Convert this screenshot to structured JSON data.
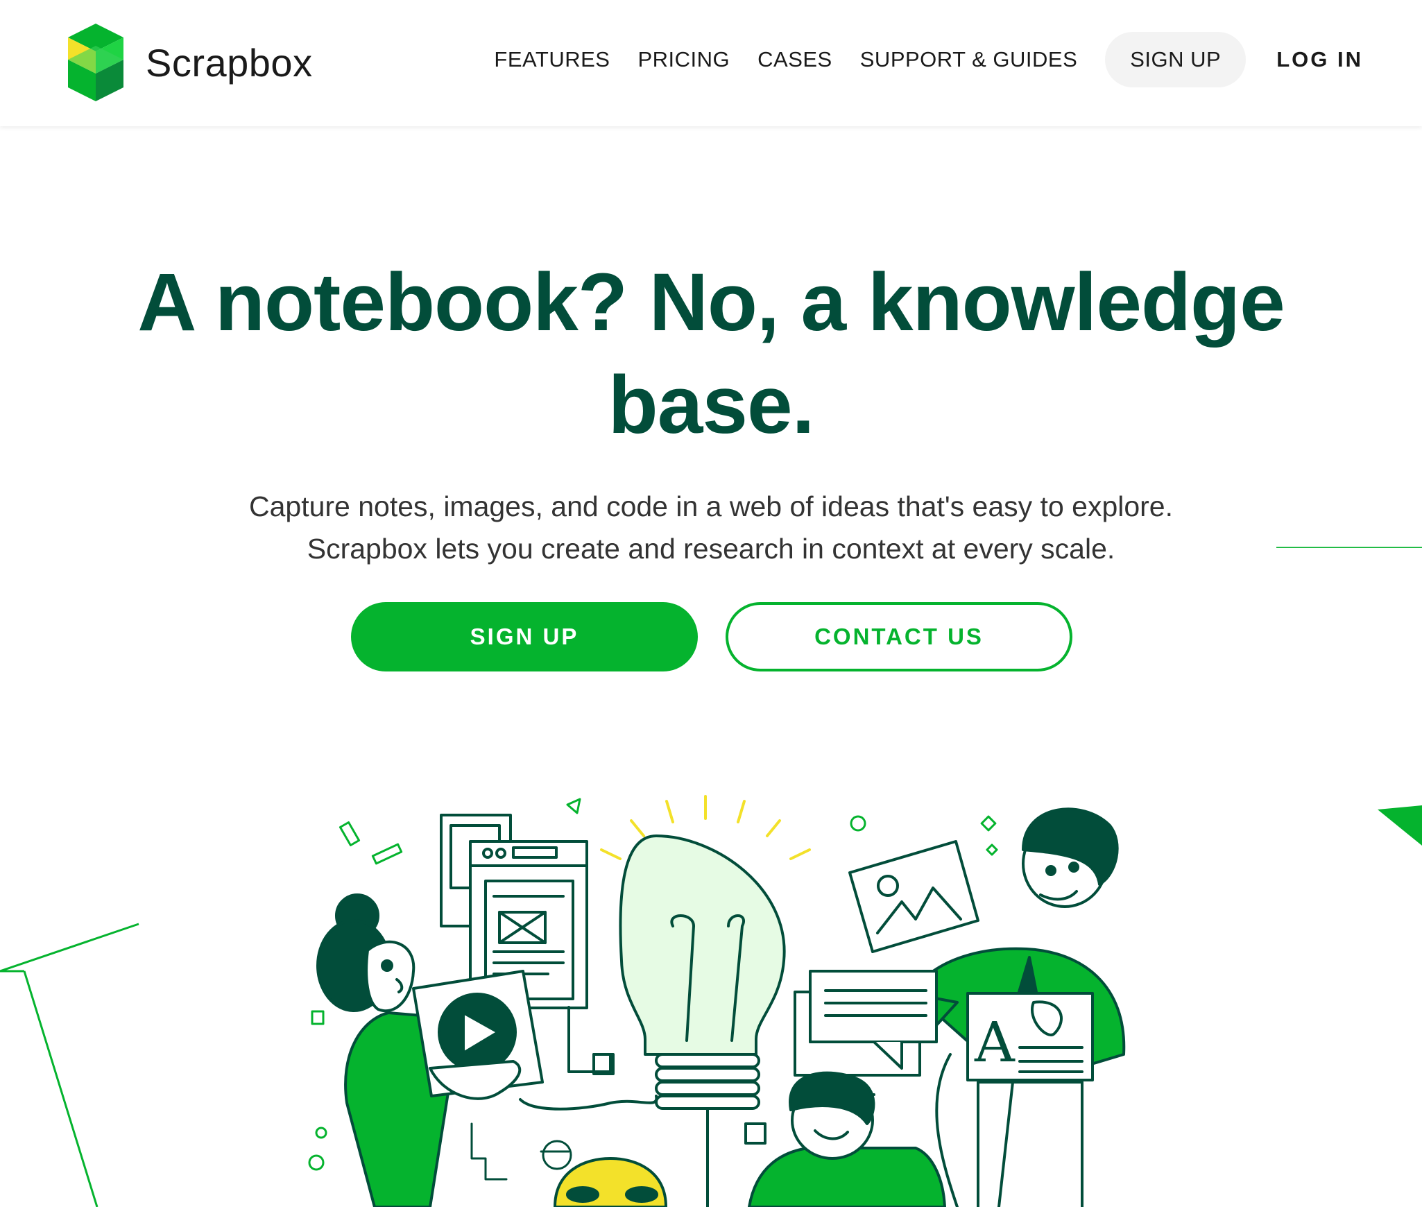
{
  "brand": {
    "name": "Scrapbox",
    "logo_icon": "scrapbox-logo-icon"
  },
  "nav": {
    "features": "FEATURES",
    "pricing": "PRICING",
    "cases": "CASES",
    "support": "SUPPORT & GUIDES",
    "signup": "SIGN UP",
    "login": "LOG IN"
  },
  "hero": {
    "title_line1": "A notebook? No, a knowledge",
    "title_line2": "base.",
    "subtitle_line1": "Capture notes, images, and code in a web of ideas that's easy to explore.",
    "subtitle_line2": "Scrapbox lets you create and research in context at every scale.",
    "signup_button": "SIGN UP",
    "contact_button": "CONTACT US"
  },
  "illustration": {
    "letter_card": "A",
    "icons": [
      "play-icon",
      "lightbulb-icon",
      "image-icon",
      "chat-bubble-icon",
      "browser-window-icon"
    ]
  },
  "colors": {
    "primary_green": "#05b32e",
    "dark_green": "#024d3a",
    "light_green": "#e6fbe4",
    "accent_yellow": "#f3e12a"
  }
}
